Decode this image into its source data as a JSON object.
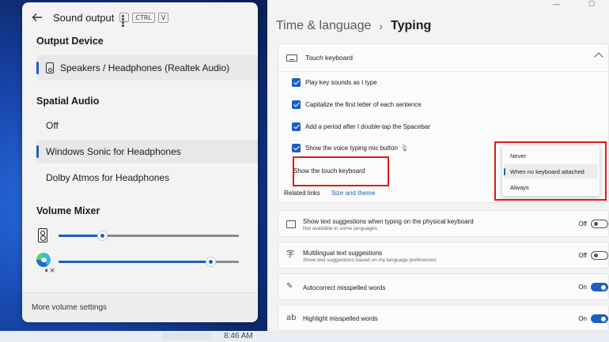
{
  "flyout": {
    "title": "Sound output",
    "shortcut_keys": [
      "CTRL",
      "V"
    ],
    "output_device_heading": "Output Device",
    "output_device": "Speakers / Headphones (Realtek Audio)",
    "spatial_audio_heading": "Spatial Audio",
    "spatial_options": [
      {
        "label": "Off",
        "selected": false
      },
      {
        "label": "Windows Sonic for Headphones",
        "selected": true
      },
      {
        "label": "Dolby Atmos for Headphones",
        "selected": false
      }
    ],
    "volume_mixer_heading": "Volume Mixer",
    "mixer": [
      {
        "app": "system-speaker",
        "level": 0.24
      },
      {
        "app": "microsoft-edge",
        "level": 0.84,
        "muted": true
      }
    ],
    "footer_link": "More volume settings"
  },
  "taskbar": {
    "clock": "8:46 AM"
  },
  "settings": {
    "breadcrumb_parent": "Time & language",
    "breadcrumb_separator": "›",
    "breadcrumb_current": "Typing",
    "touch_keyboard_title": "Touch keyboard",
    "checkboxes": [
      {
        "label": "Play key sounds as I type",
        "checked": true
      },
      {
        "label": "Capitalize the first letter of each sentence",
        "checked": true
      },
      {
        "label": "Add a period after I double-tap the Spacebar",
        "checked": true
      },
      {
        "label": "Show the voice typing mic button",
        "checked": true
      }
    ],
    "show_touch_keyboard_label": "Show the touch keyboard",
    "dropdown_options": [
      {
        "label": "Never",
        "selected": false
      },
      {
        "label": "When no keyboard attached",
        "selected": true
      },
      {
        "label": "Always",
        "selected": false
      }
    ],
    "related_links_label": "Related links",
    "related_link": "Size and theme",
    "rows": [
      {
        "title": "Show text suggestions when typing on the physical keyboard",
        "subtitle": "Not available in some languages",
        "state": "Off",
        "icon": "keyboard-icon"
      },
      {
        "title": "Multilingual text suggestions",
        "subtitle": "Show text suggestions based on my language preferences",
        "state": "Off",
        "icon": "language-icon"
      },
      {
        "title": "Autocorrect misspelled words",
        "subtitle": "",
        "state": "On",
        "icon": "autocorrect-icon"
      },
      {
        "title": "Highlight misspelled words",
        "subtitle": "",
        "state": "On",
        "icon": "spellcheck-icon"
      }
    ]
  },
  "colors": {
    "accent": "#1b5fbf",
    "highlight_box": "#e01919"
  }
}
